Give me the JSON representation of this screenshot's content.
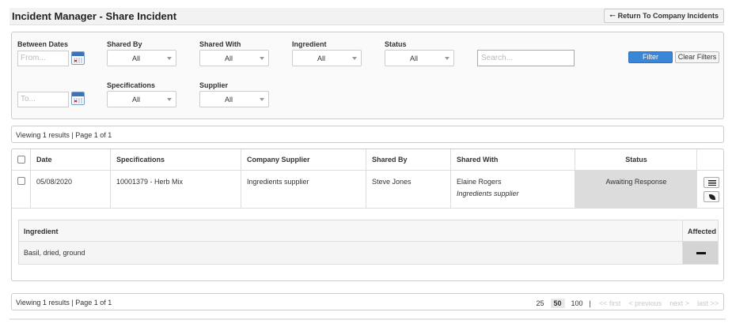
{
  "header": {
    "title": "Incident Manager - Share Incident",
    "return_button": "Return To Company Incidents"
  },
  "filters": {
    "between_dates_label": "Between Dates",
    "from_placeholder": "From...",
    "to_placeholder": "To...",
    "shared_by": {
      "label": "Shared By",
      "value": "All"
    },
    "shared_with": {
      "label": "Shared With",
      "value": "All"
    },
    "ingredient": {
      "label": "Ingredient",
      "value": "All"
    },
    "status": {
      "label": "Status",
      "value": "All"
    },
    "specifications": {
      "label": "Specifications",
      "value": "All"
    },
    "supplier": {
      "label": "Supplier",
      "value": "All"
    },
    "search_placeholder": "Search...",
    "filter_button": "Filter",
    "clear_button": "Clear Filters"
  },
  "results_summary": "Viewing 1 results | Page 1 of 1",
  "table": {
    "columns": [
      "Date",
      "Specifications",
      "Company Supplier",
      "Shared By",
      "Shared With",
      "Status"
    ],
    "rows": [
      {
        "date": "05/08/2020",
        "specification": "10001379 - Herb Mix",
        "company_supplier": "Ingredients supplier",
        "shared_by": "Steve Jones",
        "shared_with_name": "Elaine Rogers",
        "shared_with_company": "Ingredients supplier",
        "status": "Awaiting Response"
      }
    ],
    "sub_table": {
      "columns": [
        "Ingredient",
        "Affected"
      ],
      "rows": [
        {
          "ingredient": "Basil, dried, ground"
        }
      ]
    }
  },
  "pagination": {
    "page_sizes": [
      "25",
      "50",
      "100"
    ],
    "active_size": "50",
    "separator": "|",
    "first": "<< first",
    "previous": "< previous",
    "next": "next >",
    "last": "last >>"
  }
}
